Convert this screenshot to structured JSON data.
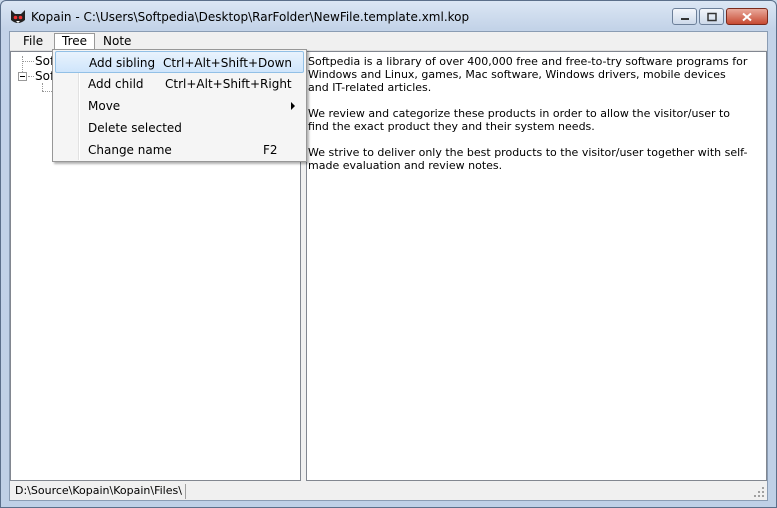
{
  "window": {
    "title": "Kopain - C:\\Users\\Softpedia\\Desktop\\RarFolder\\NewFile.template.xml.kop"
  },
  "menubar": {
    "items": [
      {
        "label": "File"
      },
      {
        "label": "Tree"
      },
      {
        "label": "Note"
      }
    ]
  },
  "tree": {
    "nodes": [
      {
        "label": "Soft"
      },
      {
        "label": "Soft"
      }
    ]
  },
  "tree_menu": {
    "items": [
      {
        "label": "Add sibling",
        "shortcut": "Ctrl+Alt+Shift+Down"
      },
      {
        "label": "Add child",
        "shortcut": "Ctrl+Alt+Shift+Right"
      },
      {
        "label": "Move",
        "shortcut": ""
      },
      {
        "label": "Delete selected",
        "shortcut": ""
      },
      {
        "label": "Change name",
        "shortcut": "F2"
      }
    ]
  },
  "note": {
    "paragraphs": [
      "Softpedia is a library of over 400,000 free and free-to-try software programs for Windows and Linux, games, Mac software, Windows drivers, mobile devices and IT-related articles.",
      "We review and categorize these products in order to allow the visitor/user to find the exact product they and their system needs.",
      "We strive to deliver only the best products to the visitor/user together with self-made evaluation and review notes."
    ]
  },
  "statusbar": {
    "path": "D:\\Source\\Kopain\\Kopain\\Files\\"
  },
  "colors": {
    "menu_hover_border": "#92c0e6",
    "close_button": "#c74a32"
  }
}
